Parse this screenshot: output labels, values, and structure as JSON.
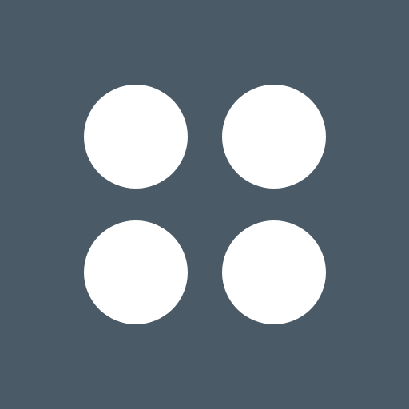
{
  "icon": {
    "name": "four-dots-grid-icon",
    "background_color": "#4a5a66",
    "dot_color": "#ffffff",
    "dots": [
      {
        "name": "dot-top-left-icon"
      },
      {
        "name": "dot-top-right-icon"
      },
      {
        "name": "dot-bottom-left-icon"
      },
      {
        "name": "dot-bottom-right-icon"
      }
    ]
  }
}
